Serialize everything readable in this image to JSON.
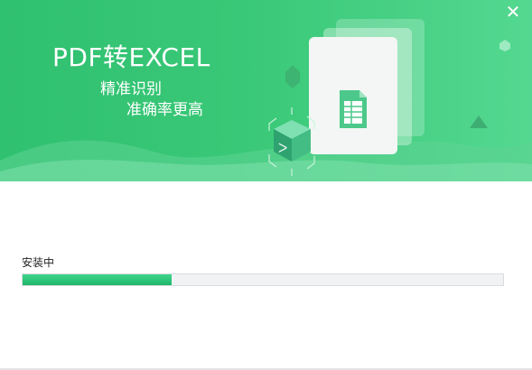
{
  "window": {
    "close_label": "✕",
    "colors": {
      "accent": "#2fc070",
      "progress": "#23b86c"
    }
  },
  "banner": {
    "title": "PDF转EXCEL",
    "slogan_line1": "精准识别",
    "slogan_line2": "准确率更高",
    "icons": [
      "pdf-cube-icon",
      "excel-document-icon"
    ]
  },
  "install": {
    "status_text": "安装中",
    "progress": 0.31
  }
}
